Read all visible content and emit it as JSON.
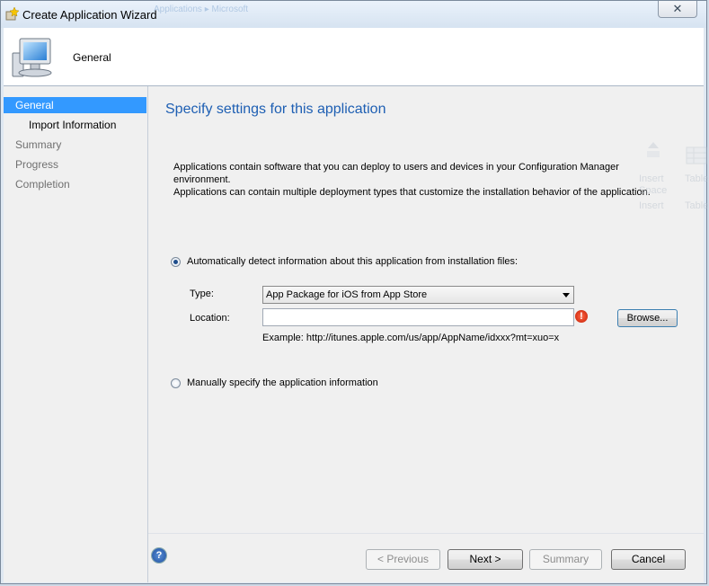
{
  "window": {
    "title": "Create Application Wizard",
    "close_symbol": "✕",
    "background_title_fragment": "Applications ▸ Microsoft"
  },
  "header": {
    "page_name": "General",
    "icon": "computer-icon"
  },
  "nav": {
    "items": [
      {
        "label": "General",
        "state": "active"
      },
      {
        "label": "Import Information",
        "state": "sub"
      },
      {
        "label": "Summary",
        "state": "inactive"
      },
      {
        "label": "Progress",
        "state": "inactive"
      },
      {
        "label": "Completion",
        "state": "inactive"
      }
    ]
  },
  "main": {
    "heading": "Specify settings for this application",
    "description_line1": "Applications contain software that you can deploy to users and devices in your Configuration Manager environment.",
    "description_line2": "Applications can contain multiple deployment types that customize the installation behavior of the application.",
    "auto_detect": {
      "label": "Automatically detect information about this application from installation files:",
      "selected": true
    },
    "type_label": "Type:",
    "type_value": "App Package for iOS from App Store",
    "location_label": "Location:",
    "location_value": "",
    "browse_label": "Browse...",
    "example_text": "Example: http://itunes.apple.com/us/app/AppName/idxxx?mt=xuo=x",
    "manual": {
      "label": "Manually specify the application information",
      "selected": false
    }
  },
  "ribbon_ghost": {
    "insert_line1": "Insert",
    "insert_line2": "Space",
    "insert_group": "Insert",
    "table_label": "Table",
    "table_group": "Table"
  },
  "footer": {
    "previous_label": "< Previous",
    "next_label": "Next >",
    "summary_label": "Summary",
    "cancel_label": "Cancel",
    "help_symbol": "?"
  },
  "colors": {
    "accent": "#3399ff",
    "heading": "#1e5fb3",
    "error": "#c41a00"
  }
}
